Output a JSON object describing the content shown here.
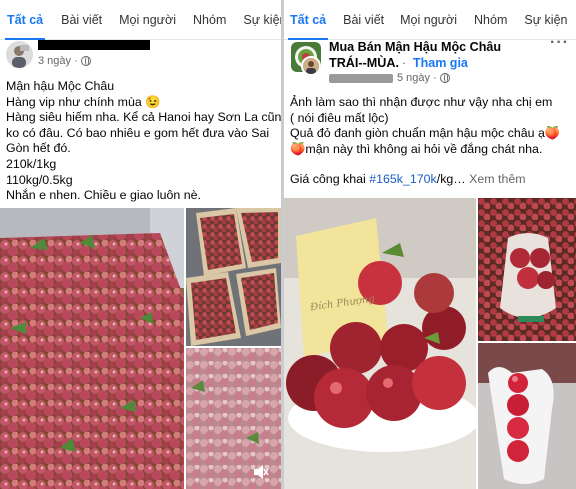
{
  "left_post": {
    "tabs": [
      "Tất cả",
      "Bài viết",
      "Mọi người",
      "Nhóm",
      "Sự kiện"
    ],
    "time": "3 ngày",
    "lines": [
      "Mận hậu Mộc Châu",
      "Hàng vip như chính mùa 😉",
      "Hàng siêu hiếm nha. Kể cả Hanoi hay Sơn La cũng",
      "ko có đâu. Có bao nhiêu e gom hết đưa vào Sai",
      "Gòn hết đó.",
      "210k/1kg",
      "110kg/0.5kg",
      "Nhắn e nhen. Chiều e giao luôn nè."
    ],
    "icons": {
      "avatar": "user-avatar",
      "privacy": "globe-icon",
      "volume": "speaker-icon"
    }
  },
  "right_post": {
    "tabs": [
      "Tất cả",
      "Bài viết",
      "Mọi người",
      "Nhóm",
      "Sự kiện"
    ],
    "group_name_line1": "Mua Bán Mận Hậu Mộc Châu",
    "group_name_line2": "TRÁI--MÙA.",
    "dot": "·",
    "join_label": "Tham gia",
    "time": "5 ngày",
    "more": "···",
    "lines": [
      "Ảnh làm sao thì nhận được như vậy nha chị em",
      "( nói điêu mất lộc)",
      "Quả đỏ đanh giòn chuẩn mận hậu mộc châu ạ🍑",
      "🍑mận này thì không ai hỏi về đắng chát nha."
    ],
    "price_prefix": "Giá công khai ",
    "price_hashtag": "#165k_170k",
    "price_suffix": "/kg…",
    "see_more": " Xem thêm",
    "sign_text": "Đích Phượng",
    "icons": {
      "avatar": "group-avatar",
      "privacy": "globe-icon",
      "more": "more-options-icon"
    }
  },
  "colors": {
    "accent": "#1877f2",
    "meta": "#65676b",
    "hashtag": "#1b5fbd"
  }
}
